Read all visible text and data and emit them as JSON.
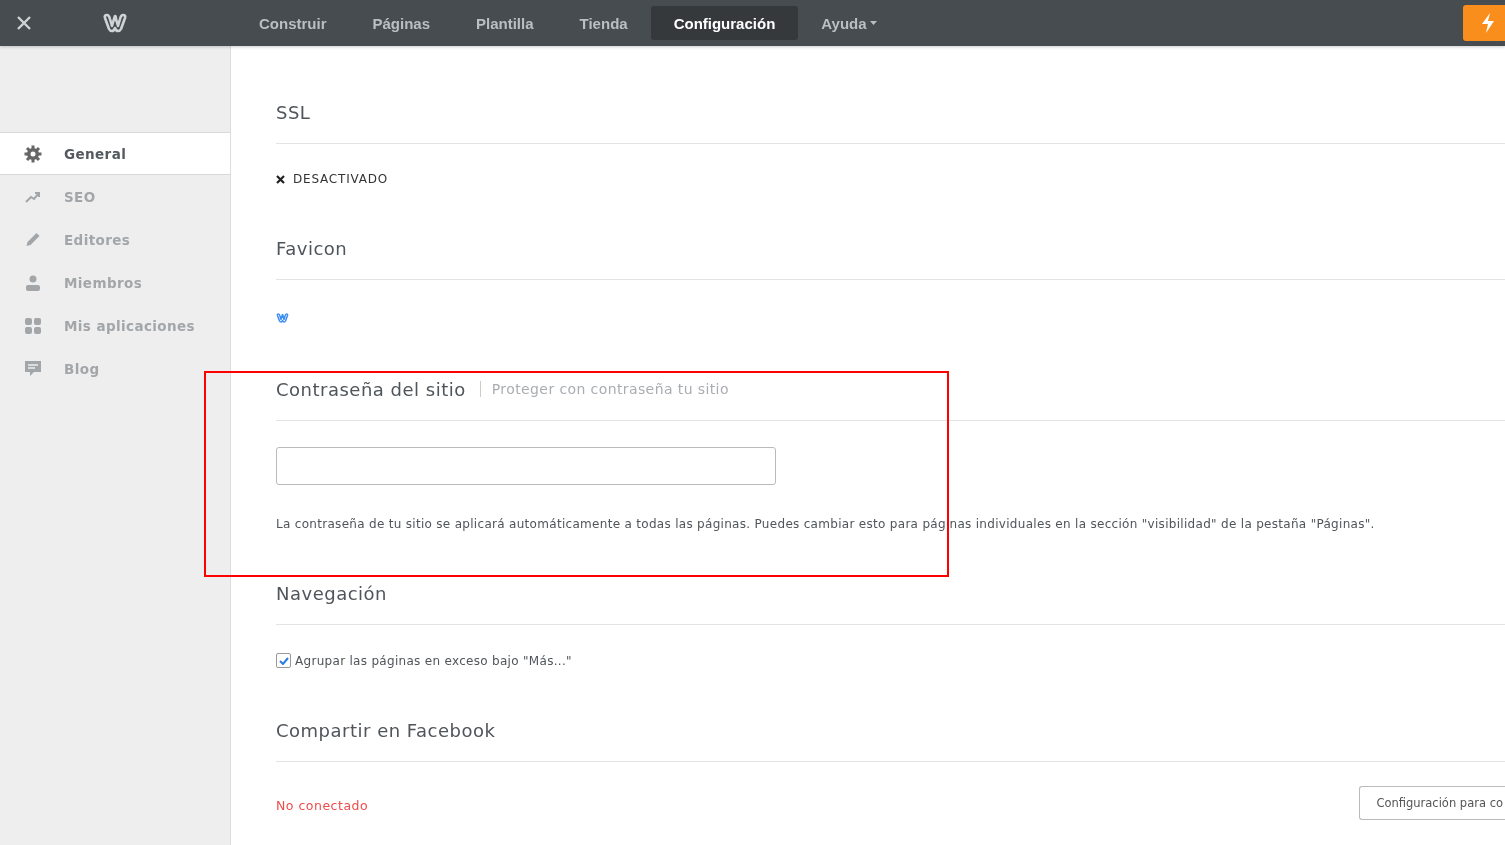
{
  "topbar": {
    "tabs": [
      {
        "label": "Construir",
        "selected": false
      },
      {
        "label": "Páginas",
        "selected": false
      },
      {
        "label": "Plantilla",
        "selected": false
      },
      {
        "label": "Tienda",
        "selected": false
      },
      {
        "label": "Configuración",
        "selected": true
      },
      {
        "label": "Ayuda",
        "selected": false,
        "dropdown": true
      }
    ]
  },
  "sidebar": {
    "items": [
      {
        "label": "General",
        "selected": true
      },
      {
        "label": "SEO",
        "selected": false
      },
      {
        "label": "Editores",
        "selected": false
      },
      {
        "label": "Miembros",
        "selected": false
      },
      {
        "label": "Mis aplicaciones",
        "selected": false
      },
      {
        "label": "Blog",
        "selected": false
      }
    ]
  },
  "sections": [
    {
      "kind": "status",
      "title": "SSL",
      "status": "DESACTIVADO"
    },
    {
      "kind": "favicon",
      "title": "Favicon"
    },
    {
      "kind": "password",
      "title": "Contraseña del sitio",
      "subtitle": "Proteger con contraseña tu sitio",
      "help": "La contraseña de tu sitio se aplicará automáticamente a todas las páginas. Puedes cambiar esto para páginas individuales en la sección \"visibilidad\" de la pestaña \"Páginas\"."
    },
    {
      "kind": "checkbox",
      "title": "Navegación",
      "label": "Agrupar las páginas en exceso bajo \"Más...\"",
      "checked": true
    },
    {
      "kind": "connect",
      "title": "Compartir en Facebook",
      "status": "No conectado",
      "button": "Configuración para co"
    }
  ],
  "annotation": {
    "kind": "frame",
    "color": "#ff0000"
  }
}
